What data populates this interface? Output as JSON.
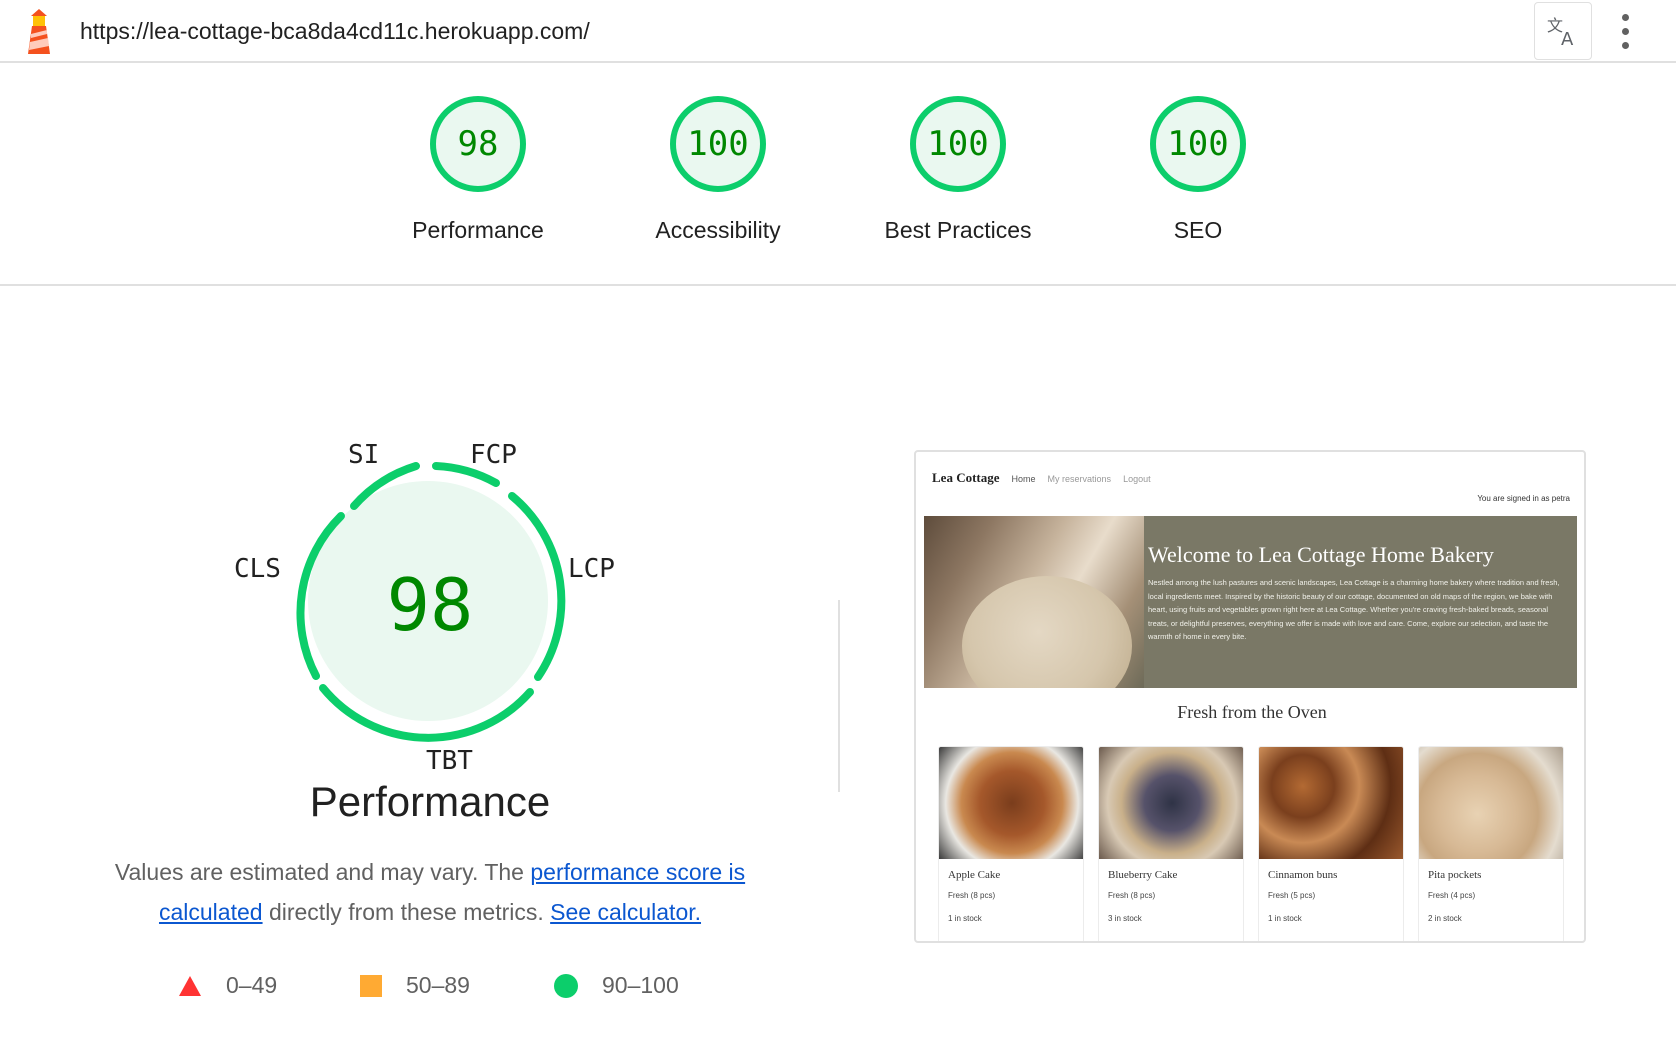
{
  "browser": {
    "url": "https://lea-cottage-bca8da4cd11c.herokuapp.com/",
    "logo_icon": "lighthouse-icon",
    "translate_icon": "translate-icon",
    "menu_icon": "kebab-menu-icon"
  },
  "score_header": {
    "categories": [
      {
        "score": "98",
        "label": "Performance"
      },
      {
        "score": "100",
        "label": "Accessibility"
      },
      {
        "score": "100",
        "label": "Best Practices"
      },
      {
        "score": "100",
        "label": "SEO"
      }
    ],
    "pass_color": "#0cce6b",
    "score_text_color": "#008800"
  },
  "performance": {
    "score": "98",
    "title": "Performance",
    "metrics": [
      "SI",
      "FCP",
      "LCP",
      "TBT",
      "CLS"
    ],
    "description_before": "Values are estimated and may vary. The ",
    "link_score": "performance score is calculated",
    "description_middle": " directly from these metrics. ",
    "link_calculator": "See calculator.",
    "legend": [
      {
        "range": "0–49",
        "shape": "triangle",
        "color": "#ff3333"
      },
      {
        "range": "50–89",
        "shape": "square",
        "color": "#ffaa33"
      },
      {
        "range": "90–100",
        "shape": "circle",
        "color": "#0cce6b"
      }
    ]
  },
  "thumbnail": {
    "brand": "Lea Cottage",
    "nav": [
      "Home",
      "My reservations",
      "Logout"
    ],
    "signed_in": "You are signed in as petra",
    "hero_title": "Welcome to Lea Cottage Home Bakery",
    "hero_text": "Nestled among the lush pastures and scenic landscapes, Lea Cottage is a charming home bakery where tradition and fresh, local ingredients meet. Inspired by the historic beauty of our cottage, documented on old maps of the region, we bake with heart, using fruits and vegetables grown right here at Lea Cottage. Whether you're craving fresh-baked breads, seasonal treats, or delightful preserves, everything we offer is made with love and care. Come, explore our selection, and taste the warmth of home in every bite.",
    "section_title": "Fresh from the Oven",
    "products": [
      {
        "name": "Apple Cake",
        "sub": "Fresh (8 pcs)",
        "stock": "1 in stock"
      },
      {
        "name": "Blueberry Cake",
        "sub": "Fresh (8 pcs)",
        "stock": "3 in stock"
      },
      {
        "name": "Cinnamon buns",
        "sub": "Fresh (5 pcs)",
        "stock": "1 in stock"
      },
      {
        "name": "Pita pockets",
        "sub": "Fresh (4 pcs)",
        "stock": "2 in stock"
      }
    ]
  }
}
